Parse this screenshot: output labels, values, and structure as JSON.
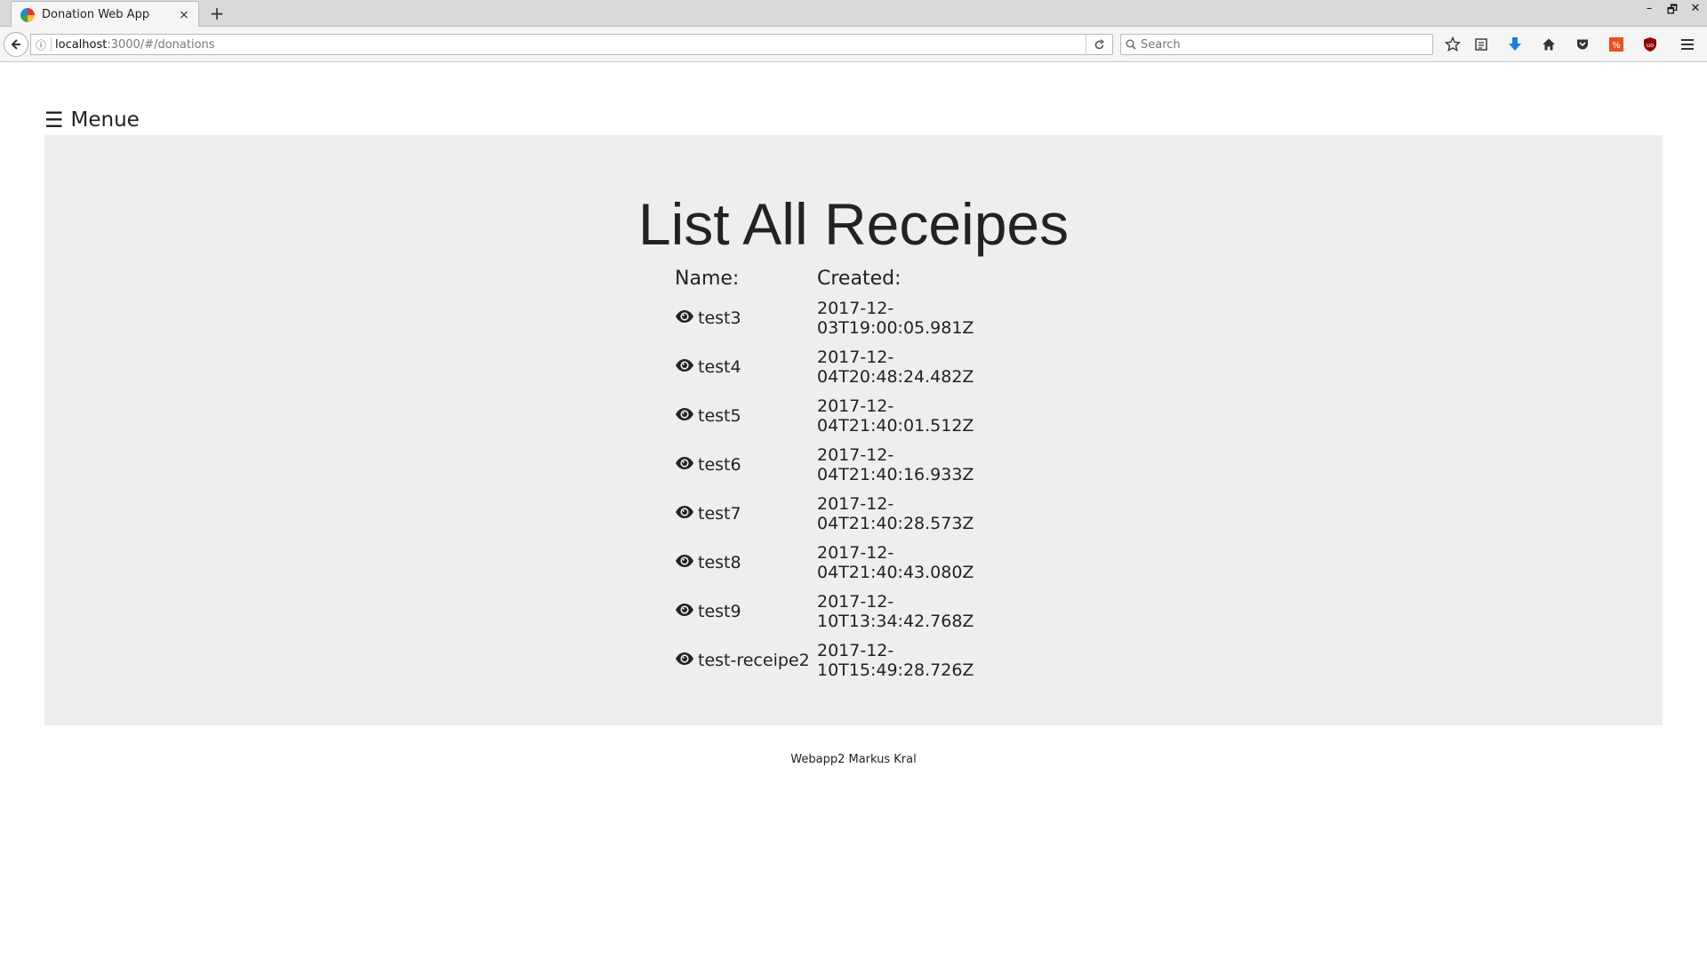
{
  "browser": {
    "tab_title": "Donation Web App",
    "tab_close": "×",
    "new_tab": "+",
    "url_host": "localhost",
    "url_path": ":3000/#/donations",
    "search_placeholder": "Search",
    "window_controls": [
      "–",
      "🗗",
      "✕"
    ]
  },
  "menu": {
    "icon": "☰",
    "label": "Menue"
  },
  "main": {
    "title": "List All Receipes",
    "columns": [
      "Name:",
      "Created:"
    ],
    "rows": [
      {
        "name": "test3",
        "created": "2017-12-03T19:00:05.981Z"
      },
      {
        "name": "test4",
        "created": "2017-12-04T20:48:24.482Z"
      },
      {
        "name": "test5",
        "created": "2017-12-04T21:40:01.512Z"
      },
      {
        "name": "test6",
        "created": "2017-12-04T21:40:16.933Z"
      },
      {
        "name": "test7",
        "created": "2017-12-04T21:40:28.573Z"
      },
      {
        "name": "test8",
        "created": "2017-12-04T21:40:43.080Z"
      },
      {
        "name": "test9",
        "created": "2017-12-10T13:34:42.768Z"
      },
      {
        "name": "test-receipe2",
        "created": "2017-12-10T15:49:28.726Z"
      }
    ]
  },
  "footer": {
    "text": "Webapp2 Markus Kral"
  },
  "icons": {
    "row_icon": "eye-icon",
    "toolbar": [
      "bookmark-star-icon",
      "reading-list-icon",
      "download-icon",
      "home-icon",
      "pocket-icon",
      "extension-icon",
      "ublock-icon",
      "hamburger-menu-icon"
    ]
  },
  "colors": {
    "panel_bg": "#eeeeee",
    "download_accent": "#1a7fd9",
    "extension_orange": "#e8501e",
    "ublock_red": "#8b0000"
  }
}
